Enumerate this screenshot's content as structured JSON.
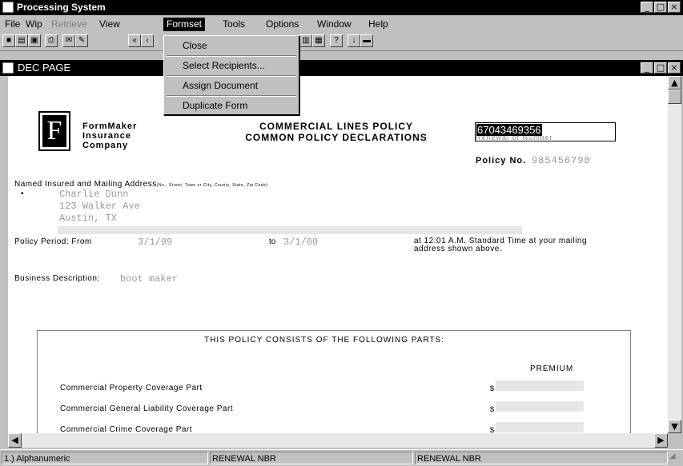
{
  "app": {
    "title": "Processing System"
  },
  "menu": [
    {
      "label": "File",
      "state": "normal"
    },
    {
      "label": "Wip",
      "state": "normal"
    },
    {
      "label": "Retrieve",
      "state": "disabled"
    },
    {
      "label": "View",
      "state": "normal"
    },
    {
      "label": "Formset",
      "state": "active"
    },
    {
      "label": "Tools",
      "state": "normal"
    },
    {
      "label": "Options",
      "state": "normal"
    },
    {
      "label": "Window",
      "state": "normal"
    },
    {
      "label": "Help",
      "state": "normal"
    }
  ],
  "formset_menu": {
    "items": [
      "Close",
      "Select Recipients...",
      "Assign Document",
      "Duplicate Form"
    ]
  },
  "document_window": {
    "title": "DEC PAGE"
  },
  "document": {
    "company_logo_letter": "F",
    "company_name": [
      "FormMaker",
      "Insurance",
      "Company"
    ],
    "heading": [
      "COMMERCIAL LINES POLICY",
      "COMMON POLICY DECLARATIONS"
    ],
    "edit_field_value": "67043469356",
    "hidden_label": "Renewal of Number",
    "policy_no_label": "Policy No.",
    "policy_no_value": "985456790",
    "named_insured_label": "Named Insured and Mailing Address",
    "named_insured_sublabel": "(No., Street, Town or City, County, State, Zip Code)",
    "insured_lines": [
      "Charlie Dunn",
      "123 Walker Ave",
      "Austin, TX"
    ],
    "policy_period_label": "Policy Period: From",
    "policy_from": "3/1/99",
    "to_label": "to",
    "policy_to": "3/1/00",
    "time_text_1": "at 12:01 A.M. Standard Time at your mailing",
    "time_text_2": "address shown above.",
    "business_label": "Business Description:",
    "business_value": "boot maker",
    "parts_heading": "THIS POLICY CONSISTS OF THE FOLLOWING PARTS:",
    "premium_label": "PREMIUM",
    "parts": [
      {
        "name": "Commercial Property Coverage Part",
        "currency": "$"
      },
      {
        "name": "Commercial General Liability Coverage Part",
        "currency": "$"
      },
      {
        "name": "Commercial Crime Coverage Part",
        "currency": "$"
      }
    ]
  },
  "statusbar": {
    "field": "1.) Alphanumeric",
    "pane2": "RENEWAL NBR",
    "pane3": "RENEWAL NBR"
  }
}
